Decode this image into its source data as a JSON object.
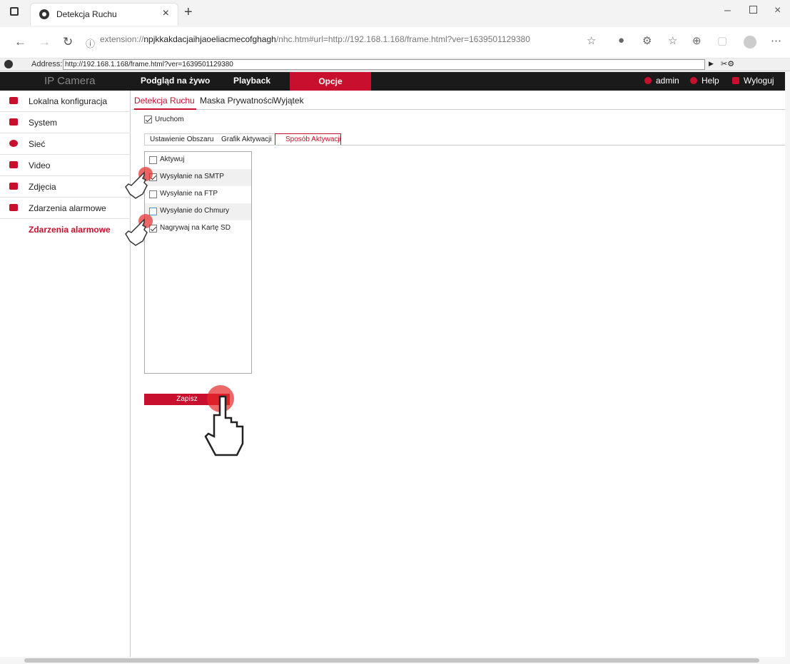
{
  "browser": {
    "tab_title": "Detekcja Ruchu",
    "url_prefix": "extension://",
    "url_host": "npjkkakdacjaihjaoeliacmecofghagh",
    "url_rest": "/nhc.htm#url=http://192.168.1.168/frame.html?ver=1639501129380",
    "address_label": "Address:",
    "address_value": "http://192.168.1.168/frame.html?ver=1639501129380"
  },
  "topnav": {
    "logo": "IP Camera",
    "items": [
      "Podgląd na żywo",
      "Playback",
      "Opcje"
    ],
    "user": "admin",
    "help": "Help",
    "logout": "Wyloguj"
  },
  "sidebar": {
    "items": [
      {
        "label": "Lokalna konfiguracja",
        "icon": "monitor-icon"
      },
      {
        "label": "System",
        "icon": "system-icon"
      },
      {
        "label": "Sieć",
        "icon": "globe-icon"
      },
      {
        "label": "Video",
        "icon": "video-icon"
      },
      {
        "label": "Zdjęcia",
        "icon": "image-icon"
      },
      {
        "label": "Zdarzenia alarmowe",
        "icon": "event-icon"
      },
      {
        "label": "Zdarzenia alarmowe",
        "icon": ""
      }
    ]
  },
  "subtabs": [
    "Detekcja Ruchu",
    "Maska Prywatności",
    "Wyjątek"
  ],
  "enable_label": "Uruchom",
  "steps": [
    "Ustawienie Obszaru",
    "Grafik Aktywacji",
    "Sposób Aktywacji"
  ],
  "actions": [
    {
      "label": "Aktywuj",
      "checked": false
    },
    {
      "label": "Wysyłanie na SMTP",
      "checked": true
    },
    {
      "label": "Wysyłanie na FTP",
      "checked": false
    },
    {
      "label": "Wysyłanie do Chmury",
      "checked": false
    },
    {
      "label": "Nagrywaj na Kartę SD",
      "checked": true
    }
  ],
  "save_label": "Zapisz",
  "colors": {
    "accent": "#c8102e",
    "nav_bg": "#1a1a1a"
  }
}
